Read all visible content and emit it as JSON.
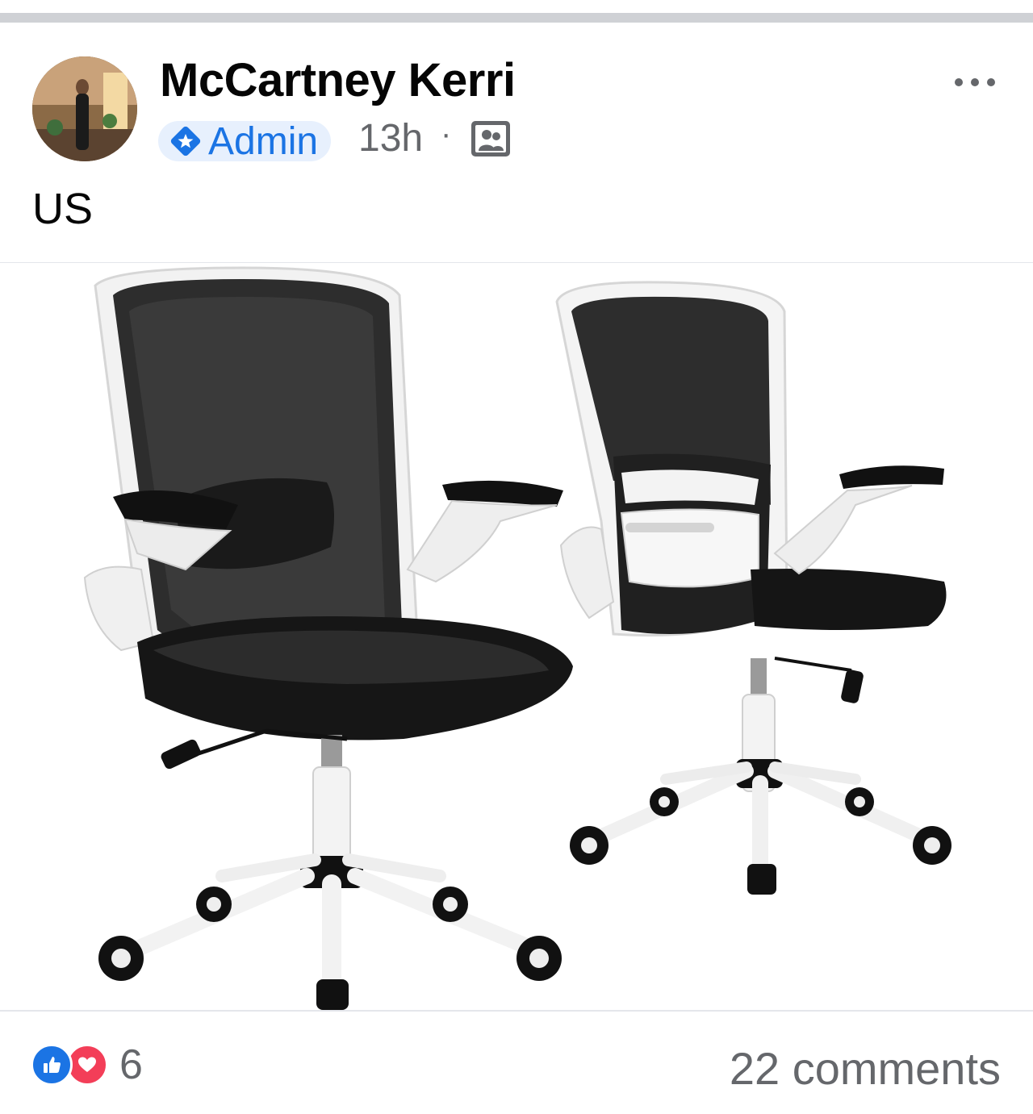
{
  "post": {
    "author_name": "McCartney Kerri",
    "author_badge": "Admin",
    "time_ago": "13h",
    "separator": "·",
    "audience_icon": "group-icon",
    "more_icon": "more-horizontal-icon",
    "text": "US"
  },
  "footer": {
    "reaction_icons": [
      "like-icon",
      "love-icon"
    ],
    "reaction_count": "6",
    "comments_label": "22 comments"
  },
  "colors": {
    "accent": "#1b74e4",
    "love": "#f33e58",
    "secondary_text": "#65676b",
    "divider": "#cfd1d5"
  }
}
